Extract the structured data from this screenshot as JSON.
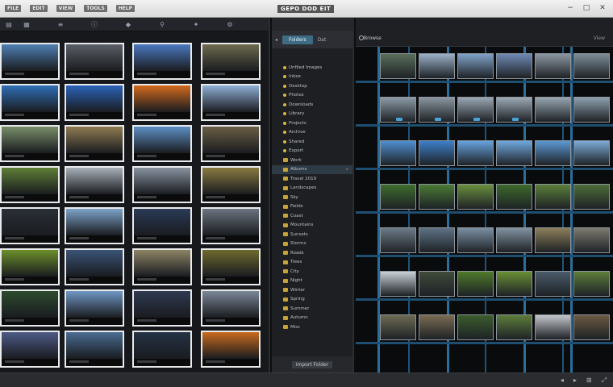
{
  "window": {
    "title": "GEPO DOD EIT",
    "menu": [
      "FILE",
      "EDIT",
      "VIEW",
      "TOOLS",
      "HELP"
    ],
    "controls": [
      "−",
      "□",
      "✕"
    ]
  },
  "left_toolbar": {
    "items": [
      {
        "icon": "folder-icon",
        "glyph": "▤"
      },
      {
        "icon": "grid-icon",
        "glyph": "▦"
      },
      {
        "icon": "list-icon",
        "glyph": "≡"
      },
      {
        "icon": "info-icon",
        "glyph": "ⓘ"
      },
      {
        "icon": "tag-icon",
        "glyph": "◆"
      },
      {
        "icon": "pin-icon",
        "glyph": "⚲"
      },
      {
        "icon": "star-icon",
        "glyph": "✦"
      },
      {
        "icon": "settings-icon",
        "glyph": "⚙"
      }
    ]
  },
  "thumbnails": {
    "colors": [
      [
        "#4f7fb3",
        "#5b5f66",
        "#4a78c0",
        "#6d6b4e"
      ],
      [
        "#2f6fb7",
        "#2b63b8",
        "#d26a1c",
        "#8fb0d6"
      ],
      [
        "#7a8f6a",
        "#8f7b52",
        "#5d8fc4",
        "#6a5f45"
      ],
      [
        "#5f7f37",
        "#a8b0b8",
        "#8892a0",
        "#8a7a42"
      ],
      [
        "#2a2f36",
        "#7da3c9",
        "#2a3a56",
        "#6c7480"
      ],
      [
        "#6c8f2a",
        "#3a5376",
        "#8d8466",
        "#6d6a2e"
      ],
      [
        "#2d4b2e",
        "#6f97c4",
        "#2f3950",
        "#7b8797"
      ],
      [
        "#4d5a86",
        "#4a6c92",
        "#243244",
        "#c86a1e"
      ]
    ]
  },
  "folder_panel": {
    "tab_active": "Folders",
    "tab_other": "Dat",
    "rows": [
      "Unfiled Images",
      "Inbox",
      "Desktop",
      "Photos",
      "Downloads",
      "Library",
      "Projects",
      "Archive",
      "Shared",
      "Export",
      "Work",
      "Albums",
      "Travel 2019",
      "Landscapes",
      "Sky",
      "Fields",
      "Coast",
      "Mountains",
      "Sunsets",
      "Storms",
      "Roads",
      "Trees",
      "City",
      "Night",
      "Winter",
      "Spring",
      "Summer",
      "Autumn",
      "Misc"
    ],
    "selected_index": 11,
    "footer_label": "Import Folder"
  },
  "right_panel": {
    "header_label": "Browse",
    "header_right": "View",
    "cell_colors": [
      [
        "#5a6e5a",
        "#9ab0c7",
        "#7fa2c8",
        "#6e88b2",
        "#8b96a1",
        "#7c8c98"
      ],
      [
        "#8c9aa6",
        "#8a96a0",
        "#9aa7b3",
        "#9ca9b4",
        "#97a6b0",
        "#8ea0ad"
      ],
      [
        "#4f8fd0",
        "#3d7fc9",
        "#66a2dd",
        "#6fa8de",
        "#5c98d2",
        "#7caad6"
      ],
      [
        "#3f6d2e",
        "#4a7a34",
        "#6a8f3e",
        "#3d6a2b",
        "#5c7f3a",
        "#4d6d38"
      ],
      [
        "#6b7a86",
        "#5e7184",
        "#7a8fa3",
        "#8292a0",
        "#8b7f5a",
        "#7d7a70"
      ],
      [
        "#c9d0d7",
        "#3f4a3a",
        "#4e7a2a",
        "#6a8f34",
        "#4a5b6a",
        "#5c7d3a"
      ],
      [
        "#6d6a54",
        "#7a6b52",
        "#3c5d2c",
        "#5d7d3a",
        "#c3c7cc",
        "#6a5a42"
      ]
    ],
    "status_icons": [
      {
        "icon": "zoom-out-icon",
        "glyph": "◂"
      },
      {
        "icon": "zoom-in-icon",
        "glyph": "▸"
      },
      {
        "icon": "fit-icon",
        "glyph": "⊞"
      },
      {
        "icon": "fullscreen-icon",
        "glyph": "⤢"
      }
    ]
  }
}
